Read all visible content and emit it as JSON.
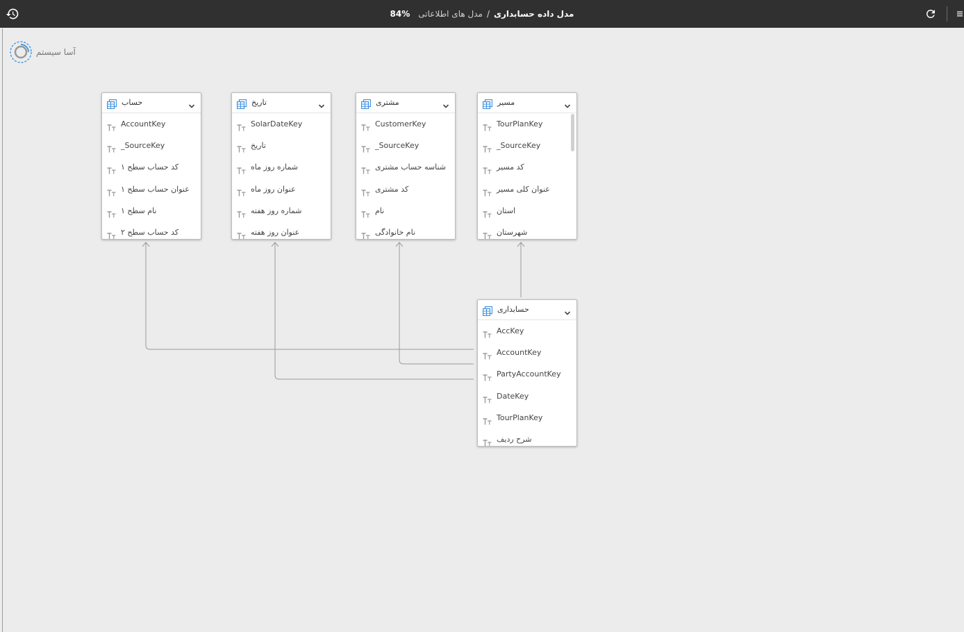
{
  "topbar": {
    "model_title": "مدل داده حسابداری",
    "separator": "/",
    "breadcrumb": "مدل های اطلاعاتی",
    "zoom": "84%"
  },
  "logo": {
    "text": "آسا سیستم"
  },
  "tables": [
    {
      "name": "حساب",
      "fields": [
        "AccountKey",
        "_SourceKey",
        "کد حساب سطح ۱",
        "عنوان حساب سطح ۱",
        "نام سطح ۱",
        "کد حساب سطح ۲"
      ]
    },
    {
      "name": "تاریخ",
      "fields": [
        "SolarDateKey",
        "تاریخ",
        "شماره روز ماه",
        "عنوان روز ماه",
        "شماره روز هفته",
        "عنوان روز هفته"
      ]
    },
    {
      "name": "مشتری",
      "fields": [
        "CustomerKey",
        "_SourceKey",
        "شناسه حساب مشتری",
        "کد مشتری",
        "نام",
        "نام خانوادگی"
      ]
    },
    {
      "name": "مسیر",
      "fields": [
        "TourPlanKey",
        "_SourceKey",
        "کد مسیر",
        "عنوان کلی مسیر",
        "استان",
        "شهرستان"
      ]
    },
    {
      "name": "حسابداری",
      "fields": [
        "AccKey",
        "AccountKey",
        "PartyAccountKey",
        "DateKey",
        "TourPlanKey",
        "شرح ردیف"
      ]
    }
  ],
  "colors": {
    "topbar": "#303030",
    "canvas": "#ececec",
    "table_icon": "#3d8fe0",
    "link_line": "#9a9a9a"
  }
}
